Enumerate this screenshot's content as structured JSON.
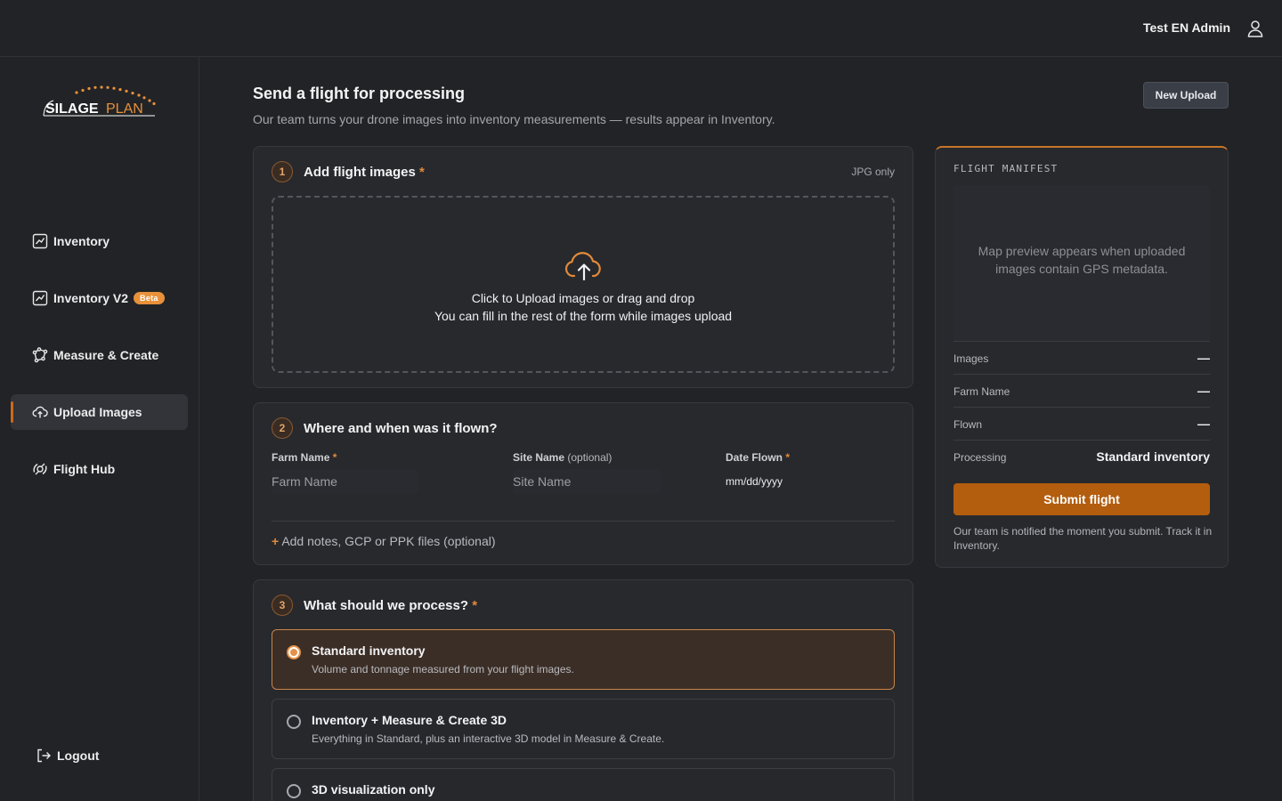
{
  "header": {
    "user_name": "Test EN Admin",
    "user_icon": "user-icon"
  },
  "sidebar": {
    "logo": {
      "text_left": "SILAGE",
      "text_right": "PLAN",
      "accent": "#e8913a"
    },
    "items": [
      {
        "label": "Inventory",
        "icon": "chart-icon"
      },
      {
        "label": "Inventory V2",
        "icon": "chart-icon",
        "badge": "Beta"
      },
      {
        "label": "Measure & Create",
        "icon": "measure-icon"
      },
      {
        "label": "Upload Images",
        "icon": "cloud-upload-icon",
        "active": true
      },
      {
        "label": "Flight Hub",
        "icon": "drone-icon"
      }
    ],
    "logout_label": "Logout"
  },
  "main": {
    "title": "Send a flight for processing",
    "subtitle": "Our team turns your drone images into inventory measurements — results appear in Inventory.",
    "new_upload_label": "New Upload",
    "step1": {
      "number": "1",
      "title": "Add flight images",
      "required_mark": "*",
      "format_hint": "JPG only",
      "drop_line1": "Click to Upload images or drag and drop",
      "drop_line2": "You can fill in the rest of the form while images upload"
    },
    "step2": {
      "number": "2",
      "title": "Where and when was it flown?",
      "farm_label": "Farm Name",
      "farm_required": "*",
      "farm_placeholder": "Farm Name",
      "site_label": "Site Name",
      "site_optional": "(optional)",
      "site_placeholder": "Site Name",
      "date_label": "Date Flown",
      "date_required": "*",
      "date_value": "mm/dd/yyyy",
      "add_notes_plus": "+",
      "add_notes_label": "Add notes, GCP or PPK files (optional)"
    },
    "step3": {
      "number": "3",
      "title": "What should we process?",
      "required_mark": "*",
      "options": [
        {
          "title": "Standard inventory",
          "desc": "Volume and tonnage measured from your flight images.",
          "selected": true
        },
        {
          "title": "Inventory + Measure & Create 3D",
          "desc": "Everything in Standard, plus an interactive 3D model in Measure & Create.",
          "selected": false
        },
        {
          "title": "3D visualization only",
          "desc": "",
          "selected": false
        }
      ]
    }
  },
  "manifest": {
    "title": "FLIGHT MANIFEST",
    "map_placeholder": "Map preview appears when uploaded images contain GPS metadata.",
    "rows": [
      {
        "label": "Images",
        "value": "—"
      },
      {
        "label": "Farm Name",
        "value": "—"
      },
      {
        "label": "Flown",
        "value": "—"
      },
      {
        "label": "Processing",
        "value": "Standard inventory"
      }
    ],
    "submit_label": "Submit flight",
    "note": "Our team is notified the moment you submit. Track it in Inventory."
  },
  "colors": {
    "accent": "#e08a3a",
    "submit": "#b35d0e",
    "background": "#222326"
  }
}
